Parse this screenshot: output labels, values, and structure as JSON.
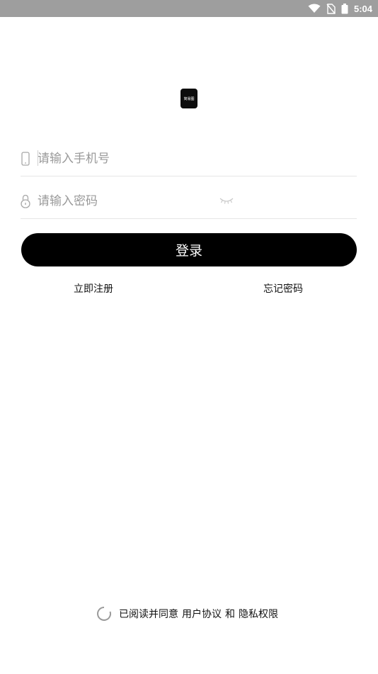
{
  "status_bar": {
    "time": "5:04",
    "icons": [
      "wifi-icon",
      "no-sim-icon",
      "battery-icon"
    ]
  },
  "logo": {
    "text": "简易图"
  },
  "login_form": {
    "phone_placeholder": "请输入手机号",
    "phone_value": "",
    "password_placeholder": "请输入密码",
    "password_value": "",
    "submit_label": "登录"
  },
  "links": {
    "register": "立即注册",
    "forgot_password": "忘记密码"
  },
  "agreement": {
    "prefix": "已阅读并同意",
    "user_agreement": "用户协议",
    "conjunction": "和",
    "privacy": "隐私权限",
    "checked": false
  },
  "colors": {
    "status_bar": "#9e9e9e",
    "button": "#000000",
    "divider": "#e6e6e6",
    "placeholder": "#9a9a9a"
  }
}
